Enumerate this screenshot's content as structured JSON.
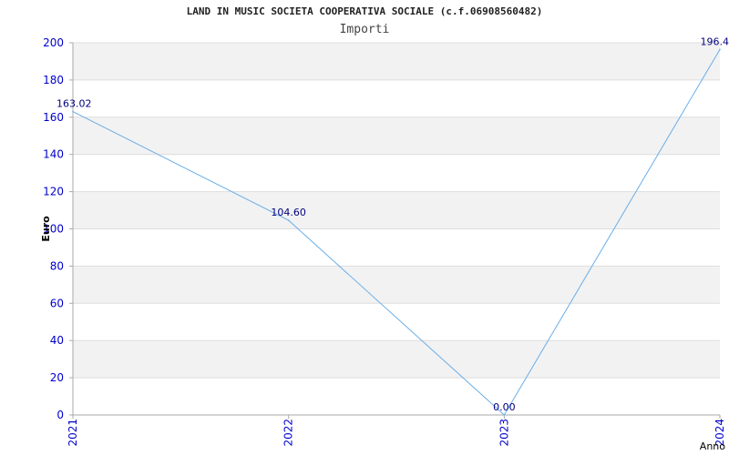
{
  "chart_data": {
    "type": "line",
    "title": "LAND IN MUSIC SOCIETA COOPERATIVA SOCIALE (c.f.06908560482)",
    "subtitle": "Importi",
    "xlabel": "Anno",
    "ylabel": "Euro",
    "categories": [
      "2021",
      "2022",
      "2023",
      "2024"
    ],
    "series": [
      {
        "values": [
          163.02,
          104.6,
          0.0,
          196.4
        ],
        "data_labels": [
          "163.02",
          "104.60",
          "0.00",
          "196.4"
        ]
      }
    ],
    "yticks": [
      0,
      20,
      40,
      60,
      80,
      100,
      120,
      140,
      160,
      180,
      200
    ],
    "ylim": [
      0,
      200
    ],
    "grid": true,
    "line_color": "#6aaee8",
    "tick_color": "#0000cc",
    "band_color": "#f2f2f2"
  }
}
